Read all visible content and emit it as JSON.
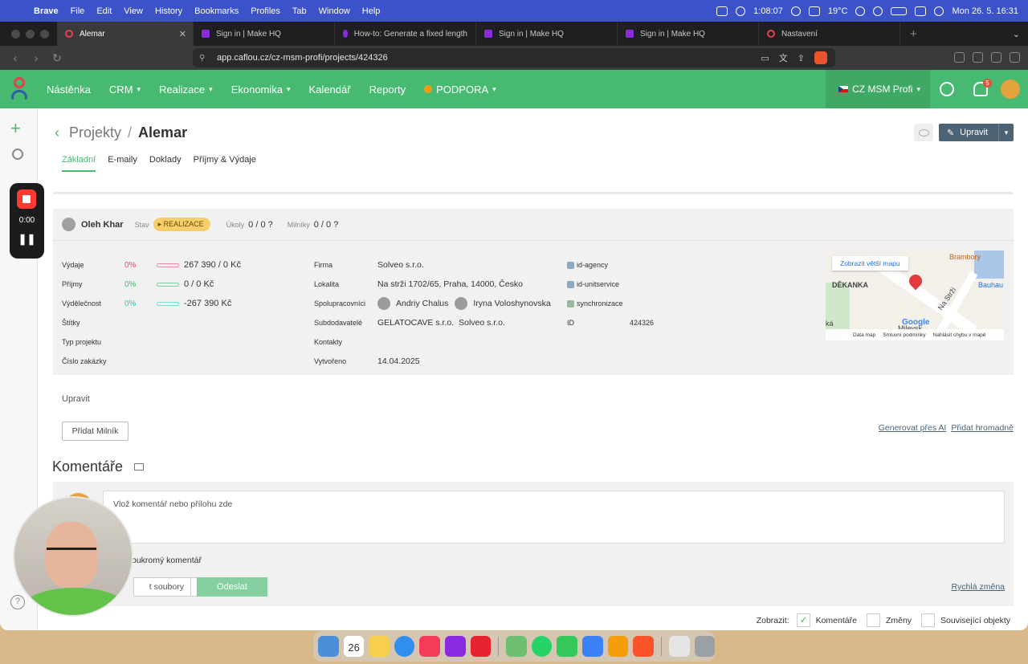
{
  "menubar": {
    "app": "Brave",
    "items": [
      "File",
      "Edit",
      "View",
      "History",
      "Bookmarks",
      "Profiles",
      "Tab",
      "Window",
      "Help"
    ],
    "clock": "1:08:07",
    "weather": "19°C",
    "datetime": "Mon 26. 5.  16:31"
  },
  "browser": {
    "tabs": [
      {
        "title": "Alemar",
        "active": true
      },
      {
        "title": "Sign in | Make HQ"
      },
      {
        "title": "How-to: Generate a fixed length"
      },
      {
        "title": "Sign in | Make HQ"
      },
      {
        "title": "Sign in | Make HQ"
      },
      {
        "title": "Nastavení"
      }
    ],
    "url": "app.caflou.cz/cz-msm-profi/projects/424326",
    "brave_badge": "6"
  },
  "app_nav": {
    "items": [
      "Nástěnka",
      "CRM",
      "Realizace",
      "Ekonomika",
      "Kalendář",
      "Reporty",
      "PODPORA"
    ],
    "org": "CZ MSM Profi",
    "notifications": "5"
  },
  "recorder": {
    "time": "0:00"
  },
  "page": {
    "breadcrumb_parent": "Projekty",
    "breadcrumb_sep": "/",
    "title": "Alemar",
    "edit_label": "Upravit",
    "tabs": [
      "Základní",
      "E-maily",
      "Doklady",
      "Příjmy & Výdaje"
    ]
  },
  "summary": {
    "owner": "Oleh Khar",
    "stav_label": "Stav",
    "stav_value": "REALIZACE",
    "ukoly_label": "Úkoly",
    "ukoly_value": "0 / 0 ?",
    "milniky_label": "Milníky",
    "milniky_value": "0 / 0 ?"
  },
  "finance": [
    {
      "label": "Výdaje",
      "pct": "0%",
      "value": "267 390 / 0 Kč"
    },
    {
      "label": "Příjmy",
      "pct": "0%",
      "value": "0 / 0 Kč"
    },
    {
      "label": "Výdělečnost",
      "pct": "0%",
      "value": "-267 390 Kč"
    },
    {
      "label": "Štítky",
      "pct": "",
      "value": ""
    },
    {
      "label": "Typ projektu",
      "pct": "",
      "value": ""
    },
    {
      "label": "Číslo zakázky",
      "pct": "",
      "value": ""
    }
  ],
  "details": {
    "firma_label": "Firma",
    "firma": "Solveo s.r.o.",
    "lokalita_label": "Lokalita",
    "lokalita": "Na strži 1702/65, Praha, 14000, Česko",
    "spolupracovnici_label": "Spolupracovníci",
    "spolupracovnici": [
      "Andriy Chalus",
      "Iryna Voloshynovska"
    ],
    "subdodavatele_label": "Subdodavatelé",
    "subdodavatele": [
      "GELATOCAVE s.r.o.",
      "Solveo s.r.o."
    ],
    "kontakty_label": "Kontakty",
    "vytvoreno_label": "Vytvořeno",
    "vytvoreno": "14.04.2025"
  },
  "integrations": {
    "items": [
      "id-agency",
      "id-unitservice",
      "synchronizace"
    ],
    "id_label": "ID",
    "id_value": "424326"
  },
  "map": {
    "link": "Zobrazit větší mapu",
    "labels": [
      "Brambory",
      "DĚKANKA",
      "Na Strži",
      "Bauhau",
      "Milevsk",
      "ká"
    ],
    "google": "Google",
    "footer": [
      "Data map",
      "Smluvní podmínky",
      "Nahlásit chybu v mapě"
    ]
  },
  "actions": {
    "upravit": "Upravit",
    "pridat_milnik": "Přidat Milník",
    "generovat_ai": "Generovat přes AI",
    "pridat_hromadne": "Přidat hromadně"
  },
  "comments": {
    "title": "Komentáře",
    "placeholder": "Vlož komentář nebo přílohu zde",
    "private": "oukromý komentář",
    "files_button": "t soubory",
    "send": "Odeslat",
    "quick_change": "Rychlá změna",
    "show_label": "Zobrazit:",
    "filters": [
      {
        "label": "Komentáře",
        "checked": true
      },
      {
        "label": "Změny",
        "checked": false
      },
      {
        "label": "Související objekty",
        "checked": false
      }
    ]
  },
  "dock": {
    "calendar_day": "26",
    "calendar_month": "MAY"
  }
}
